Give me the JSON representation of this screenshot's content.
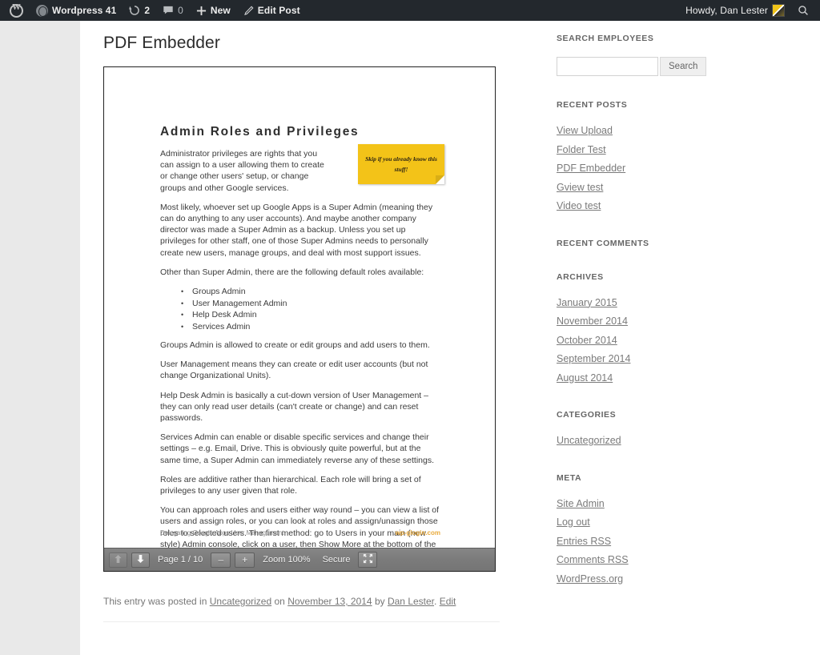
{
  "adminbar": {
    "wp_logo": "wordpress-logo-icon",
    "site_name": "Wordpress 41",
    "comments_count": "0",
    "updates_count": "2",
    "new_label": "New",
    "edit_label": "Edit Post",
    "howdy": "Howdy, Dan Lester",
    "search_icon": "search-icon"
  },
  "main": {
    "entry_title": "PDF Embedder",
    "meta_prefix": "This entry was posted in",
    "meta_category": "Uncategorized",
    "meta_on": "on",
    "meta_date": "November 13, 2014",
    "meta_by": "by",
    "meta_author": "Dan Lester",
    "meta_period": ".",
    "meta_edit": "Edit"
  },
  "pdf": {
    "heading": "Admin Roles and Privileges",
    "paragraphs": [
      "Administrator privileges are rights that you can assign to a user allowing them to create or change other users' setup, or change groups and other Google services.",
      "Most likely, whoever set up Google Apps is a Super Admin (meaning they can do anything to any user accounts). And maybe another company director was made a Super Admin as a backup. Unless you set up privileges for other staff, one of those Super Admins needs to personally create new users, manage groups, and deal with most support issues.",
      "Other than Super Admin, there are the following default roles available:"
    ],
    "roles": [
      "Groups Admin",
      "User Management Admin",
      "Help Desk Admin",
      "Services Admin"
    ],
    "paragraphs2": [
      "Groups Admin is allowed to create or edit groups and add users to them.",
      "User Management means they can create or edit user accounts (but not change Organizational Units).",
      "Help Desk Admin is basically a cut-down version of User Management – they can only read user details (can't create or change) and can reset passwords.",
      "Services Admin can enable or disable specific services and change their settings – e.g. Email, Drive. This is obviously quite powerful, but at the same time, a Super Admin can immediately reverse any of these settings.",
      "Roles are additive rather than hierarchical. Each role will bring a set of privileges to any user given that role.",
      "You can approach roles and users either way round – you can view a list of users and assign roles, or you can look at roles and assign/unassign those roles to selected users. The first method: go to Users in your main (new style) Admin console, click on a user, then Show More at the bottom of the screen. Find “Admin roles and its privileges”."
    ],
    "sticky_note": "Skip if you already know this stuff!",
    "footer_left": "Delegating Google Apps User Management",
    "footer_right": "wp-glogin.com"
  },
  "toolbar": {
    "prev_icon": "arrow-up-icon",
    "next_icon": "arrow-down-icon",
    "page_label": "Page 1 / 10",
    "zoom_out_icon": "minus-icon",
    "zoom_in_icon": "plus-icon",
    "zoom_label": "Zoom 100%",
    "secure_label": "Secure",
    "fullscreen_icon": "fullscreen-icon"
  },
  "sidebar": {
    "search_widget": {
      "title": "Search Employees",
      "input_value": "",
      "input_placeholder": "",
      "button_label": "Search"
    },
    "recent_posts": {
      "title": "Recent Posts",
      "items": [
        "View Upload",
        "Folder Test",
        "PDF Embedder",
        "Gview test",
        "Video test"
      ]
    },
    "recent_comments": {
      "title": "Recent Comments",
      "items": []
    },
    "archives": {
      "title": "Archives",
      "items": [
        "January 2015",
        "November 2014",
        "October 2014",
        "September 2014",
        "August 2014"
      ]
    },
    "categories": {
      "title": "Categories",
      "items": [
        "Uncategorized"
      ]
    },
    "meta": {
      "title": "Meta",
      "items": [
        "Site Admin",
        "Log out",
        "Entries RSS",
        "Comments RSS",
        "WordPress.org"
      ]
    }
  },
  "colors": {
    "adminbar_bg": "#23282d",
    "page_bg": "#e9e9e9",
    "sticky_yellow": "#f3c318",
    "brand_orange": "#e8a93a",
    "toolbar_gray": "#7b7b7b"
  }
}
